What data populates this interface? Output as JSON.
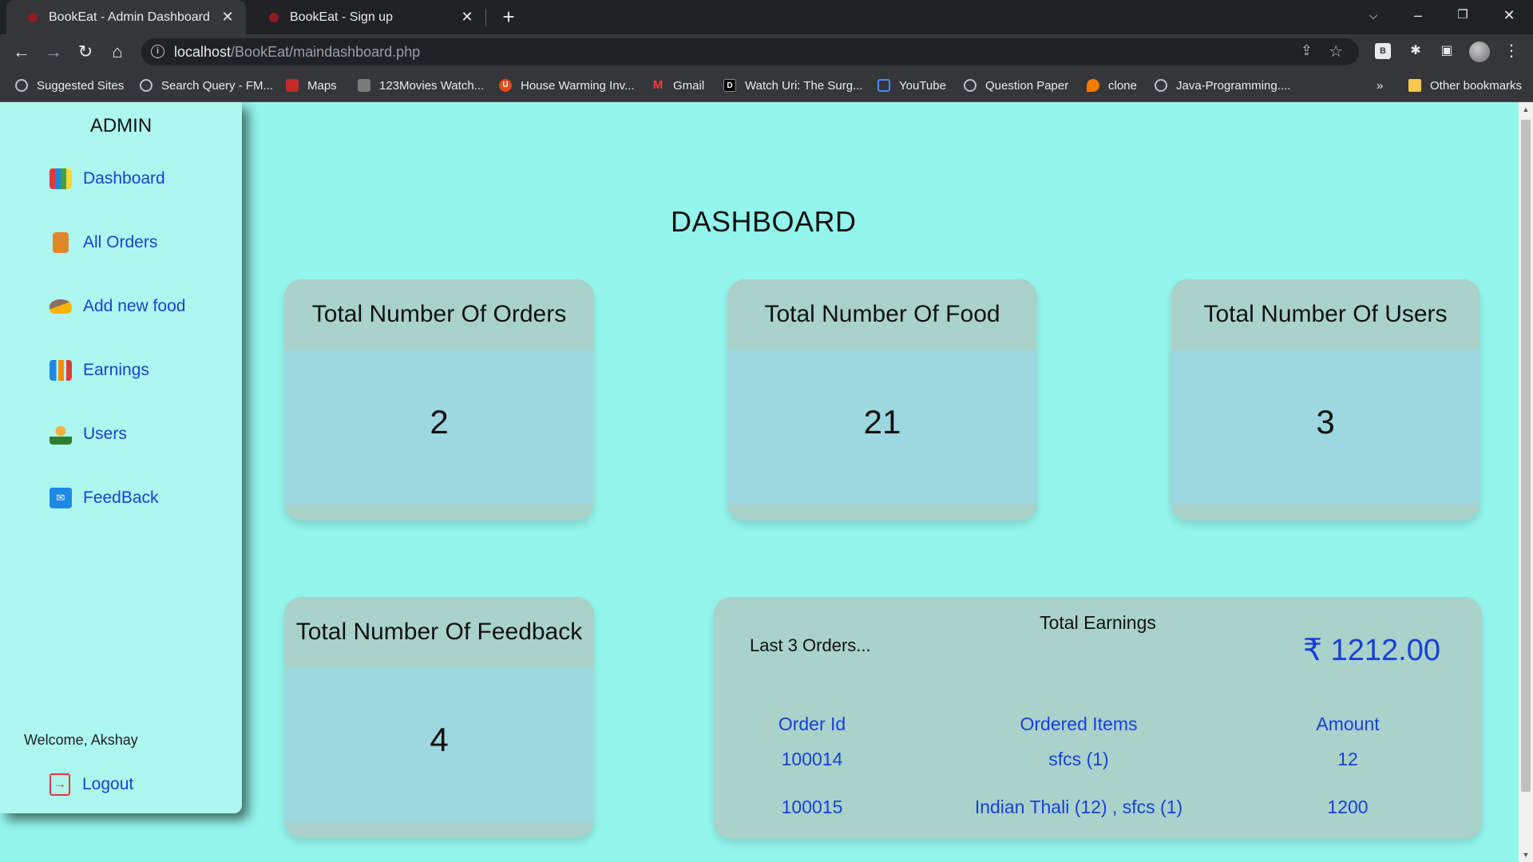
{
  "browser": {
    "tabs": [
      {
        "title": "BookEat - Admin Dashboard"
      },
      {
        "title": "BookEat - Sign up"
      }
    ],
    "url_host": "localhost",
    "url_path": "/BookEat/maindashboard.php",
    "bookmarks": [
      {
        "label": "Suggested Sites",
        "icon": "globe-icon"
      },
      {
        "label": "Search Query - FM...",
        "icon": "globe-icon"
      },
      {
        "label": "Maps",
        "icon": "maps-icon"
      },
      {
        "label": "123Movies Watch...",
        "icon": "movie-icon"
      },
      {
        "label": "House Warming Inv...",
        "icon": "up-icon"
      },
      {
        "label": "Gmail",
        "icon": "gmail-icon"
      },
      {
        "label": "Watch Uri: The Surg...",
        "icon": "d-icon"
      },
      {
        "label": "YouTube",
        "icon": "youtube-icon"
      },
      {
        "label": "Question Paper",
        "icon": "globe-icon"
      },
      {
        "label": "clone",
        "icon": "pin-icon"
      },
      {
        "label": "Java-Programming....",
        "icon": "globe-icon"
      }
    ],
    "other_bookmarks": "Other bookmarks",
    "overflow": "»"
  },
  "sidebar": {
    "title": "ADMIN",
    "items": [
      {
        "label": "Dashboard",
        "icon": "dashboard-icon"
      },
      {
        "label": "All Orders",
        "icon": "orders-icon"
      },
      {
        "label": "Add new food",
        "icon": "food-icon"
      },
      {
        "label": "Earnings",
        "icon": "earnings-icon"
      },
      {
        "label": "Users",
        "icon": "users-icon"
      },
      {
        "label": "FeedBack",
        "icon": "feedback-icon"
      }
    ],
    "welcome": "Welcome, Akshay",
    "logout": "Logout"
  },
  "main": {
    "title": "DASHBOARD",
    "cards": [
      {
        "title": "Total Number Of Orders",
        "value": "2"
      },
      {
        "title": "Total Number Of Food",
        "value": "21"
      },
      {
        "title": "Total Number Of Users",
        "value": "3"
      },
      {
        "title": "Total Number Of Feedback",
        "value": "4"
      }
    ],
    "earnings": {
      "title": "Total Earnings",
      "subtitle": "Last 3 Orders...",
      "amount": "₹ 1212.00",
      "columns": [
        "Order Id",
        "Ordered Items",
        "Amount"
      ],
      "rows": [
        {
          "order_id": "100014",
          "items": "sfcs (1)",
          "amount": "12"
        },
        {
          "order_id": "100015",
          "items": "Indian Thali (12) , sfcs (1)",
          "amount": "1200"
        }
      ]
    }
  },
  "colors": {
    "page_bg": "#93f5ec",
    "sidebar_bg": "#adf7f0",
    "card_header": "#a9d2cb",
    "card_body": "#9dd7df",
    "link_blue": "#1a3fd6"
  }
}
